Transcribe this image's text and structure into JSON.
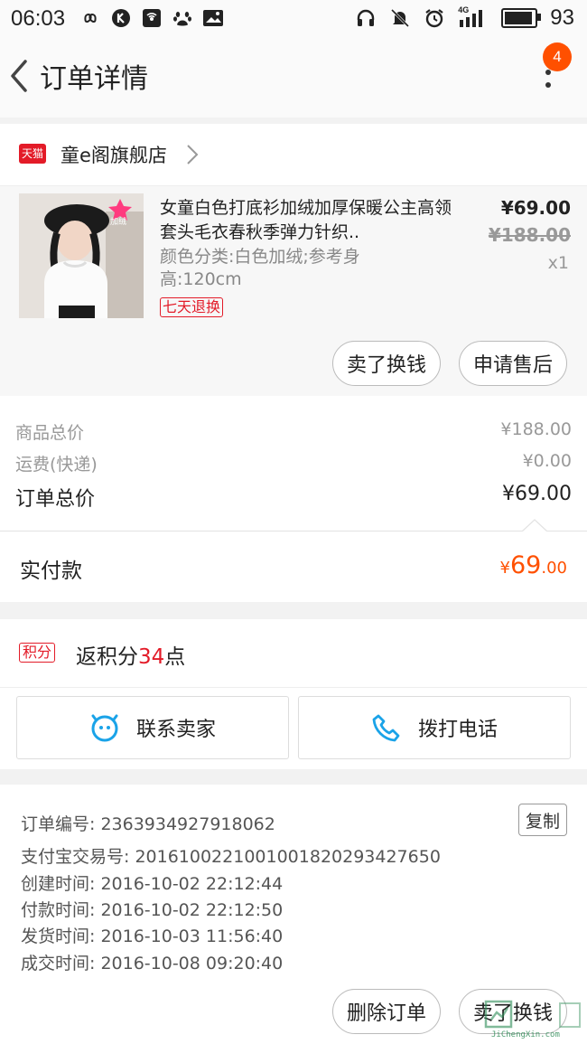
{
  "status_bar": {
    "time": "06:03",
    "battery_level": "93",
    "network": "4G"
  },
  "header": {
    "title": "订单详情",
    "badge_count": "4"
  },
  "store": {
    "logo_text": "天猫",
    "name": "童e阁旗舰店"
  },
  "product": {
    "title": "女童白色打底衫加绒加厚保暖公主高领套头毛衣春秋季弹力针织..",
    "spec": "颜色分类:白色加绒;参考身高:120cm",
    "thumb_badge": "加绒",
    "tag": "七天退换",
    "price": "¥69.00",
    "original_price": "¥188.00",
    "quantity": "x1",
    "actions": [
      "卖了换钱",
      "申请售后"
    ]
  },
  "summary": {
    "rows": [
      {
        "label": "商品总价",
        "value": "¥188.00"
      },
      {
        "label": "运费(快递)",
        "value": "¥0.00"
      }
    ],
    "total_label": "订单总价",
    "total_value": "¥69.00"
  },
  "paid": {
    "label": "实付款",
    "currency": "¥",
    "int": "69",
    "dec": ".00"
  },
  "points": {
    "tag": "积分",
    "prefix": "返积分",
    "count": "34",
    "suffix": "点"
  },
  "contact": {
    "seller_label": "联系卖家",
    "phone_label": "拨打电话"
  },
  "order_info": {
    "lines": [
      "订单编号: 2363934927918062",
      "支付宝交易号: 2016100221001001820293427650",
      "创建时间: 2016-10-02 22:12:44",
      "付款时间: 2016-10-02 22:12:50",
      "发货时间: 2016-10-03 11:56:40",
      "成交时间: 2016-10-08 09:20:40"
    ],
    "copy_label": "复制"
  },
  "bottom_actions": [
    "删除订单",
    "卖了换钱"
  ],
  "watermark": {
    "text": "JiChengXin.com"
  },
  "colors": {
    "accent": "#ff5000",
    "tmall_red": "#e31b28"
  }
}
